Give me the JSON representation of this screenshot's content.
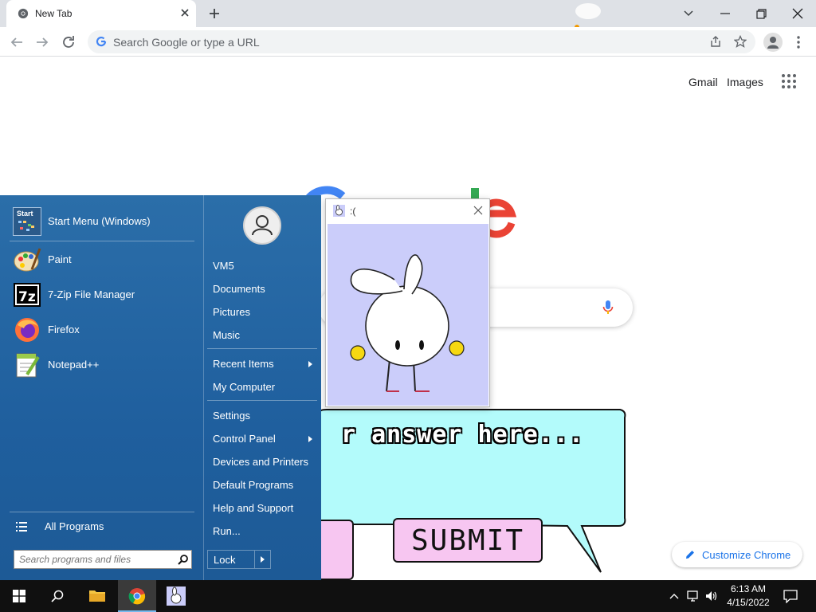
{
  "browser": {
    "tab_title": "New Tab",
    "omnibox_placeholder": "Search Google or type a URL"
  },
  "page": {
    "gmail": "Gmail",
    "images": "Images",
    "customize": "Customize Chrome",
    "bubble_text": "r answer here...",
    "submit": "SUBMIT"
  },
  "popup": {
    "title": ":("
  },
  "start_menu": {
    "programs": [
      {
        "label": "Start Menu (Windows)",
        "icon": "start-menu-icon"
      },
      {
        "label": "Paint",
        "icon": "paint-icon"
      },
      {
        "label": "7-Zip File Manager",
        "icon": "7zip-icon"
      },
      {
        "label": "Firefox",
        "icon": "firefox-icon"
      },
      {
        "label": "Notepad++",
        "icon": "notepadpp-icon"
      }
    ],
    "start_icon_text": "Start",
    "all_programs": "All Programs",
    "search_placeholder": "Search programs and files",
    "right_links": {
      "user": "VM5",
      "documents": "Documents",
      "pictures": "Pictures",
      "music": "Music",
      "recent": "Recent Items",
      "computer": "My Computer",
      "settings": "Settings",
      "control_panel": "Control Panel",
      "devices": "Devices and Printers",
      "defaults": "Default Programs",
      "help": "Help and Support",
      "run": "Run..."
    },
    "lock": "Lock"
  },
  "taskbar": {
    "time": "6:13 AM",
    "date": "4/15/2022"
  }
}
